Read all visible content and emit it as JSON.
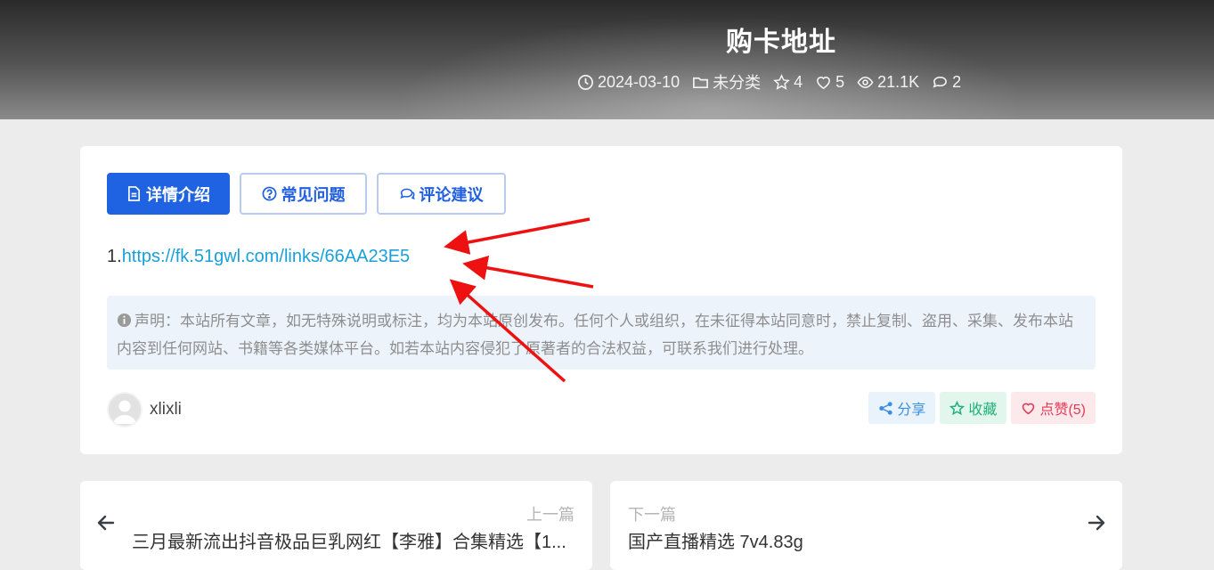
{
  "hero": {
    "title": "购卡地址",
    "meta": {
      "date": "2024-03-10",
      "category": "未分类",
      "stars": "4",
      "likes": "5",
      "views": "21.1K",
      "comments": "2"
    }
  },
  "tabs": [
    {
      "label": "详情介绍",
      "icon": "document-icon",
      "active": true
    },
    {
      "label": "常见问题",
      "icon": "question-circle-icon",
      "active": false
    },
    {
      "label": "评论建议",
      "icon": "comments-icon",
      "active": false
    }
  ],
  "content": {
    "link_prefix": "1.",
    "link_text": "https://fk.51gwl.com/links/66AA23E5"
  },
  "notice": {
    "text": "声明：本站所有文章，如无特殊说明或标注，均为本站原创发布。任何个人或组织，在未征得本站同意时，禁止复制、盗用、采集、发布本站内容到任何网站、书籍等各类媒体平台。如若本站内容侵犯了原著者的合法权益，可联系我们进行处理。"
  },
  "author": {
    "name": "xlixli"
  },
  "actions": {
    "share": "分享",
    "favorite": "收藏",
    "like": "点赞(5)"
  },
  "navigation": {
    "prev_label": "上一篇",
    "prev_title": "三月最新流出抖音极品巨乳网红【李雅】合集精选【1...",
    "next_label": "下一篇",
    "next_title": "国产直播精选 7v4.83g"
  },
  "colors": {
    "primary": "#1f62e2",
    "link": "#1aa0d8",
    "annotation_arrow": "#ee1111"
  }
}
